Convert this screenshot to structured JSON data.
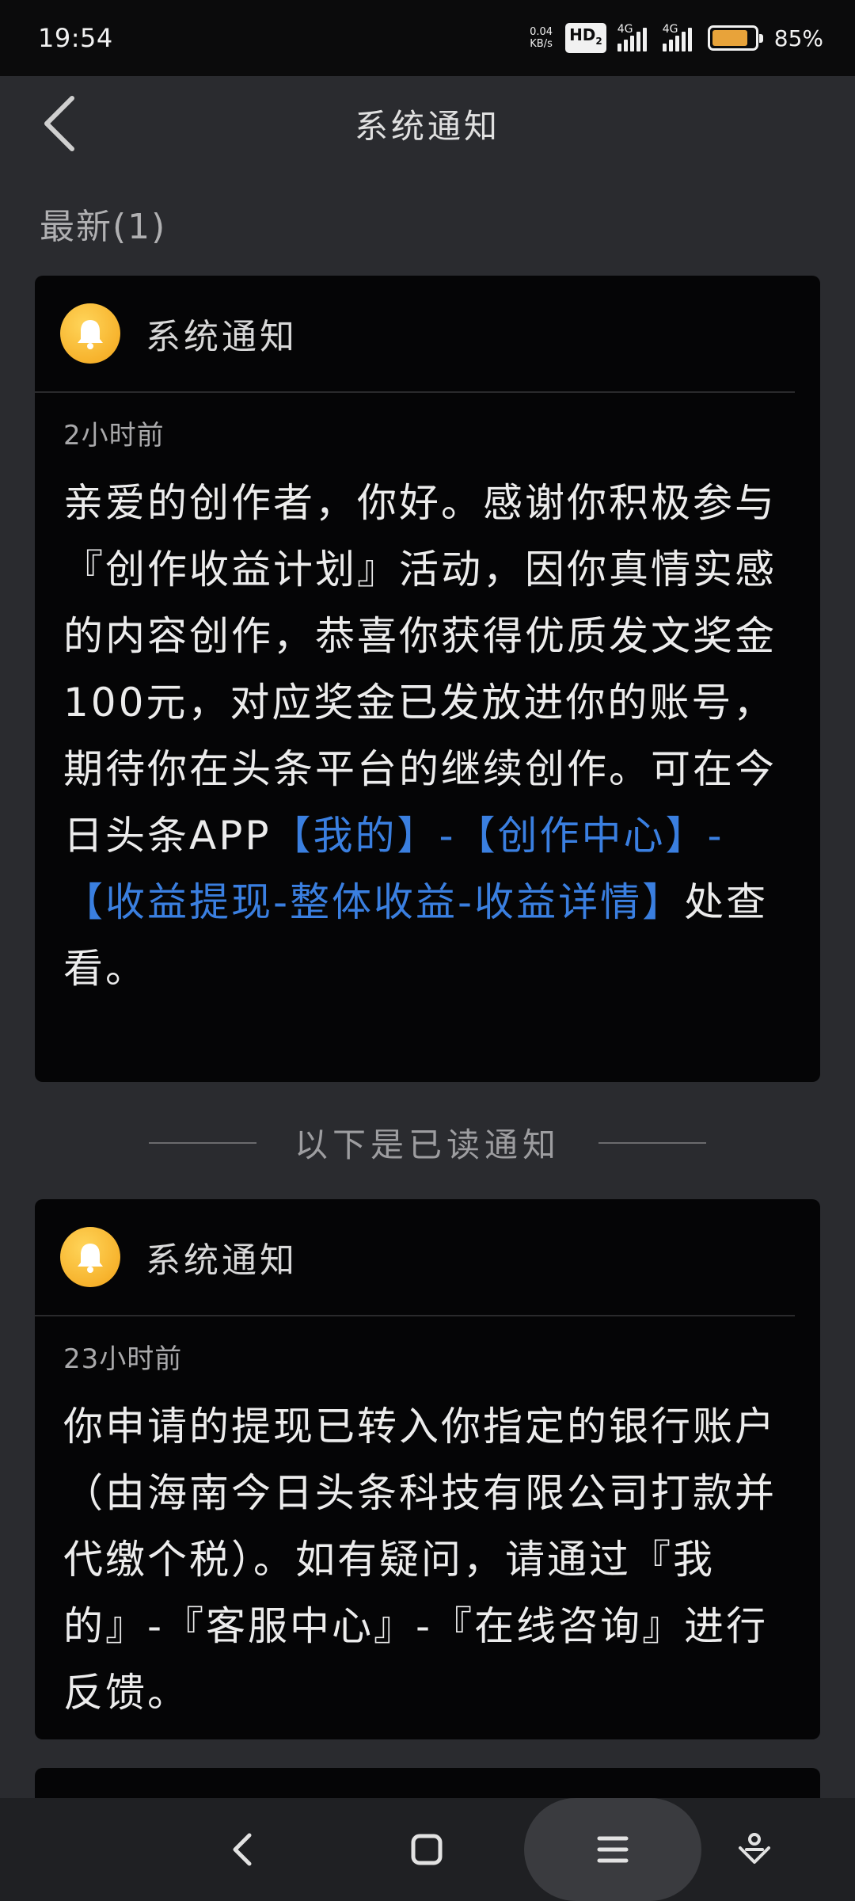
{
  "status_bar": {
    "time": "19:54",
    "net_speed_value": "0.04",
    "net_speed_unit": "KB/s",
    "hd_label": "HD",
    "hd_sub": "2",
    "sim1_net": "4G",
    "sim2_net": "4G",
    "battery_level": 0.85,
    "battery_percent": "85%",
    "battery_color": "#e8a33a"
  },
  "nav": {
    "title": "系统通知"
  },
  "section": {
    "latest_label": "最新(1)"
  },
  "notifications": [
    {
      "title": "系统通知",
      "time": "2小时前",
      "text_before": "亲爱的创作者，你好。感谢你积极参与『创作收益计划』活动，因你真情实感的内容创作，恭喜你获得优质发文奖金100元，对应奖金已发放进你的账号，期待你在头条平台的继续创作。可在今日头条APP",
      "link": "【我的】-【创作中心】-【收益提现-整体收益-收益详情】",
      "text_after": "处查看。"
    },
    {
      "title": "系统通知",
      "time": "23小时前",
      "text": "你申请的提现已转入你指定的银行账户（由海南今日头条科技有限公司打款并代缴个税）。如有疑问，请通过『我的』-『客服中心』-『在线咨询』进行反馈。"
    }
  ],
  "divider": {
    "label": "以下是已读通知"
  },
  "colors": {
    "background": "#2a2b2f",
    "card": "#050506",
    "link": "#3a7fe0",
    "bell": "#f3a419"
  },
  "icons": {
    "back": "back-arrow-icon",
    "bell": "bell-icon",
    "home": "square-home-icon",
    "menu": "hamburger-menu-icon",
    "extra": "accessibility-person-icon"
  }
}
